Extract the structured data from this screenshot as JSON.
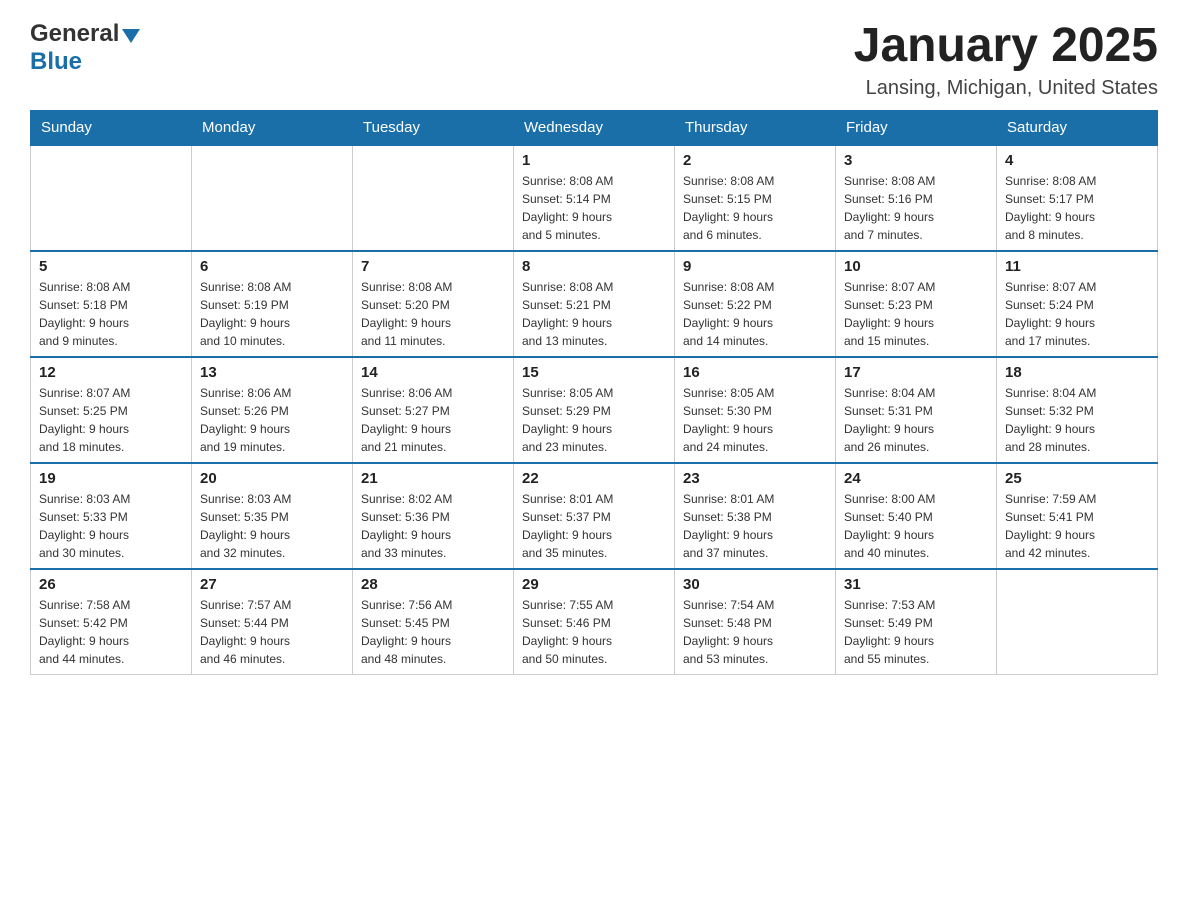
{
  "header": {
    "logo_general": "General",
    "logo_blue": "Blue",
    "month_title": "January 2025",
    "location": "Lansing, Michigan, United States"
  },
  "weekdays": [
    "Sunday",
    "Monday",
    "Tuesday",
    "Wednesday",
    "Thursday",
    "Friday",
    "Saturday"
  ],
  "weeks": [
    [
      {
        "day": "",
        "info": ""
      },
      {
        "day": "",
        "info": ""
      },
      {
        "day": "",
        "info": ""
      },
      {
        "day": "1",
        "info": "Sunrise: 8:08 AM\nSunset: 5:14 PM\nDaylight: 9 hours\nand 5 minutes."
      },
      {
        "day": "2",
        "info": "Sunrise: 8:08 AM\nSunset: 5:15 PM\nDaylight: 9 hours\nand 6 minutes."
      },
      {
        "day": "3",
        "info": "Sunrise: 8:08 AM\nSunset: 5:16 PM\nDaylight: 9 hours\nand 7 minutes."
      },
      {
        "day": "4",
        "info": "Sunrise: 8:08 AM\nSunset: 5:17 PM\nDaylight: 9 hours\nand 8 minutes."
      }
    ],
    [
      {
        "day": "5",
        "info": "Sunrise: 8:08 AM\nSunset: 5:18 PM\nDaylight: 9 hours\nand 9 minutes."
      },
      {
        "day": "6",
        "info": "Sunrise: 8:08 AM\nSunset: 5:19 PM\nDaylight: 9 hours\nand 10 minutes."
      },
      {
        "day": "7",
        "info": "Sunrise: 8:08 AM\nSunset: 5:20 PM\nDaylight: 9 hours\nand 11 minutes."
      },
      {
        "day": "8",
        "info": "Sunrise: 8:08 AM\nSunset: 5:21 PM\nDaylight: 9 hours\nand 13 minutes."
      },
      {
        "day": "9",
        "info": "Sunrise: 8:08 AM\nSunset: 5:22 PM\nDaylight: 9 hours\nand 14 minutes."
      },
      {
        "day": "10",
        "info": "Sunrise: 8:07 AM\nSunset: 5:23 PM\nDaylight: 9 hours\nand 15 minutes."
      },
      {
        "day": "11",
        "info": "Sunrise: 8:07 AM\nSunset: 5:24 PM\nDaylight: 9 hours\nand 17 minutes."
      }
    ],
    [
      {
        "day": "12",
        "info": "Sunrise: 8:07 AM\nSunset: 5:25 PM\nDaylight: 9 hours\nand 18 minutes."
      },
      {
        "day": "13",
        "info": "Sunrise: 8:06 AM\nSunset: 5:26 PM\nDaylight: 9 hours\nand 19 minutes."
      },
      {
        "day": "14",
        "info": "Sunrise: 8:06 AM\nSunset: 5:27 PM\nDaylight: 9 hours\nand 21 minutes."
      },
      {
        "day": "15",
        "info": "Sunrise: 8:05 AM\nSunset: 5:29 PM\nDaylight: 9 hours\nand 23 minutes."
      },
      {
        "day": "16",
        "info": "Sunrise: 8:05 AM\nSunset: 5:30 PM\nDaylight: 9 hours\nand 24 minutes."
      },
      {
        "day": "17",
        "info": "Sunrise: 8:04 AM\nSunset: 5:31 PM\nDaylight: 9 hours\nand 26 minutes."
      },
      {
        "day": "18",
        "info": "Sunrise: 8:04 AM\nSunset: 5:32 PM\nDaylight: 9 hours\nand 28 minutes."
      }
    ],
    [
      {
        "day": "19",
        "info": "Sunrise: 8:03 AM\nSunset: 5:33 PM\nDaylight: 9 hours\nand 30 minutes."
      },
      {
        "day": "20",
        "info": "Sunrise: 8:03 AM\nSunset: 5:35 PM\nDaylight: 9 hours\nand 32 minutes."
      },
      {
        "day": "21",
        "info": "Sunrise: 8:02 AM\nSunset: 5:36 PM\nDaylight: 9 hours\nand 33 minutes."
      },
      {
        "day": "22",
        "info": "Sunrise: 8:01 AM\nSunset: 5:37 PM\nDaylight: 9 hours\nand 35 minutes."
      },
      {
        "day": "23",
        "info": "Sunrise: 8:01 AM\nSunset: 5:38 PM\nDaylight: 9 hours\nand 37 minutes."
      },
      {
        "day": "24",
        "info": "Sunrise: 8:00 AM\nSunset: 5:40 PM\nDaylight: 9 hours\nand 40 minutes."
      },
      {
        "day": "25",
        "info": "Sunrise: 7:59 AM\nSunset: 5:41 PM\nDaylight: 9 hours\nand 42 minutes."
      }
    ],
    [
      {
        "day": "26",
        "info": "Sunrise: 7:58 AM\nSunset: 5:42 PM\nDaylight: 9 hours\nand 44 minutes."
      },
      {
        "day": "27",
        "info": "Sunrise: 7:57 AM\nSunset: 5:44 PM\nDaylight: 9 hours\nand 46 minutes."
      },
      {
        "day": "28",
        "info": "Sunrise: 7:56 AM\nSunset: 5:45 PM\nDaylight: 9 hours\nand 48 minutes."
      },
      {
        "day": "29",
        "info": "Sunrise: 7:55 AM\nSunset: 5:46 PM\nDaylight: 9 hours\nand 50 minutes."
      },
      {
        "day": "30",
        "info": "Sunrise: 7:54 AM\nSunset: 5:48 PM\nDaylight: 9 hours\nand 53 minutes."
      },
      {
        "day": "31",
        "info": "Sunrise: 7:53 AM\nSunset: 5:49 PM\nDaylight: 9 hours\nand 55 minutes."
      },
      {
        "day": "",
        "info": ""
      }
    ]
  ]
}
